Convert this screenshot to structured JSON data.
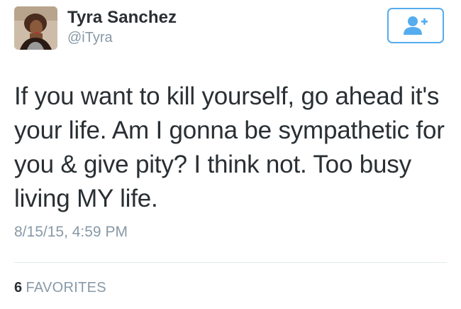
{
  "user": {
    "display_name": "Tyra Sanchez",
    "handle": "@iTyra",
    "avatar_icon": "profile-photo"
  },
  "follow_button": {
    "icon": "follow-user-plus-icon",
    "accent_color": "#55acee"
  },
  "tweet": {
    "text": "If you want to kill yourself, go ahead it's your life. Am I gonna be sympathetic for you & give pity? I think not. Too busy living MY life.",
    "timestamp": "8/15/15, 4:59 PM"
  },
  "stats": {
    "favorites_count": "6",
    "favorites_label": "FAVORITES"
  },
  "colors": {
    "text": "#292f33",
    "secondary_text": "#8899a6",
    "divider": "#e1e8ed",
    "accent": "#55acee"
  }
}
